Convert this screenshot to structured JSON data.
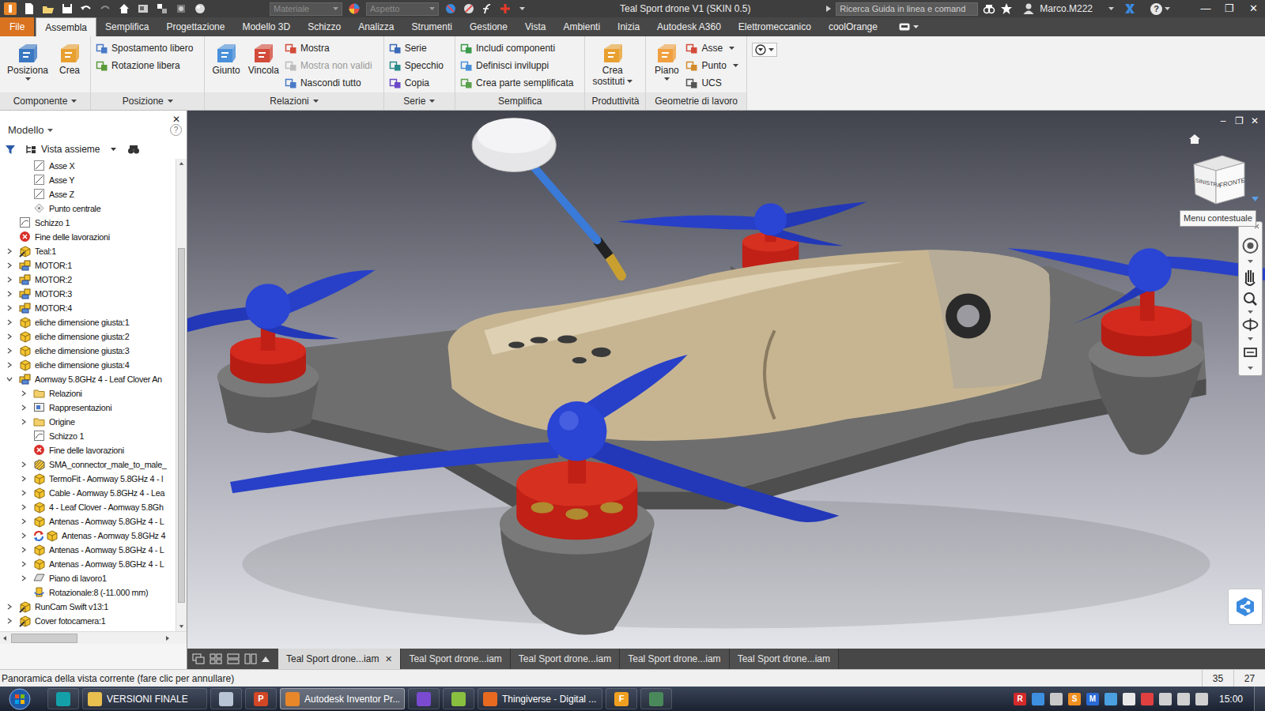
{
  "window": {
    "title": "Teal Sport drone V1 (SKIN 0.5)",
    "controls": [
      "—",
      "❐",
      "✕"
    ]
  },
  "title_bar": {
    "material": "Materiale",
    "appearance": "Aspetto",
    "search": {
      "placeholder": "Ricerca Guida in linea e comand"
    },
    "user": "Marco.M222",
    "help": "?"
  },
  "ribbon_tabs": [
    {
      "label": "File",
      "selected": false,
      "kind": "application"
    },
    {
      "label": "Assembla",
      "selected": true,
      "kind": "tab"
    },
    {
      "label": "Semplifica",
      "selected": false,
      "kind": "tab"
    },
    {
      "label": "Progettazione",
      "selected": false,
      "kind": "tab"
    },
    {
      "label": "Modello 3D",
      "selected": false,
      "kind": "tab"
    },
    {
      "label": "Schizzo",
      "selected": false,
      "kind": "tab"
    },
    {
      "label": "Analizza",
      "selected": false,
      "kind": "tab"
    },
    {
      "label": "Strumenti",
      "selected": false,
      "kind": "tab"
    },
    {
      "label": "Gestione",
      "selected": false,
      "kind": "tab"
    },
    {
      "label": "Vista",
      "selected": false,
      "kind": "tab"
    },
    {
      "label": "Ambienti",
      "selected": false,
      "kind": "tab"
    },
    {
      "label": "Inizia",
      "selected": false,
      "kind": "tab"
    },
    {
      "label": "Autodesk A360",
      "selected": false,
      "kind": "tab"
    },
    {
      "label": "Elettromeccanico",
      "selected": false,
      "kind": "tab"
    },
    {
      "label": "coolOrange",
      "selected": false,
      "kind": "tab"
    }
  ],
  "ribbon_panels": [
    {
      "label": "Componente",
      "menu": true,
      "buttons": [
        {
          "kind": "large",
          "lines": [
            "Posiziona"
          ],
          "dropdown": true,
          "disabled": false
        },
        {
          "kind": "large",
          "lines": [
            "Crea"
          ],
          "dropdown": false,
          "disabled": false
        }
      ]
    },
    {
      "label": "Posizione",
      "menu": true,
      "buttons": [
        {
          "kind": "small",
          "label": "Spostamento libero",
          "dropdown": false,
          "disabled": false
        },
        {
          "kind": "small",
          "label": "Rotazione libera",
          "dropdown": false,
          "disabled": false
        }
      ]
    },
    {
      "label": "Relazioni",
      "menu": true,
      "buttons": [
        {
          "kind": "large",
          "lines": [
            "Giunto"
          ],
          "dropdown": false,
          "disabled": false
        },
        {
          "kind": "large",
          "lines": [
            "Vincola"
          ],
          "dropdown": false,
          "disabled": false
        },
        {
          "kind": "small",
          "label": "Mostra",
          "dropdown": false,
          "disabled": false
        },
        {
          "kind": "small",
          "label": "Mostra non validi",
          "dropdown": false,
          "disabled": true
        },
        {
          "kind": "small",
          "label": "Nascondi tutto",
          "dropdown": false,
          "disabled": false
        }
      ]
    },
    {
      "label": "Serie",
      "menu": true,
      "buttons": [
        {
          "kind": "small",
          "label": "Serie",
          "dropdown": false,
          "disabled": false
        },
        {
          "kind": "small",
          "label": "Specchio",
          "dropdown": false,
          "disabled": false
        },
        {
          "kind": "small",
          "label": "Copia",
          "dropdown": false,
          "disabled": false
        }
      ]
    },
    {
      "label": "Semplifica",
      "menu": false,
      "buttons": [
        {
          "kind": "small",
          "label": "Includi componenti",
          "dropdown": false,
          "disabled": false
        },
        {
          "kind": "small",
          "label": "Definisci inviluppi",
          "dropdown": false,
          "disabled": false
        },
        {
          "kind": "small",
          "label": "Crea parte semplificata",
          "dropdown": false,
          "disabled": false
        }
      ]
    },
    {
      "label": "Produttività",
      "menu": false,
      "buttons": [
        {
          "kind": "large",
          "lines": [
            "Crea",
            "sostituti"
          ],
          "dropdown": true,
          "disabled": false
        }
      ]
    },
    {
      "label": "Geometrie di lavoro",
      "menu": false,
      "buttons": [
        {
          "kind": "large",
          "lines": [
            "Piano"
          ],
          "dropdown": true,
          "disabled": false
        },
        {
          "kind": "small",
          "label": "Asse",
          "dropdown": true,
          "disabled": false
        },
        {
          "kind": "small",
          "label": "Punto",
          "dropdown": true,
          "disabled": false
        },
        {
          "kind": "small",
          "label": "UCS",
          "dropdown": false,
          "disabled": false
        }
      ]
    }
  ],
  "browser": {
    "title": "Modello",
    "help": "?",
    "close": "✕",
    "view": "Vista assieme",
    "items": [
      {
        "label": "Asse X",
        "depth": 2,
        "kind": "axis",
        "has_children": false,
        "expanded": false
      },
      {
        "label": "Asse Y",
        "depth": 2,
        "kind": "axis",
        "has_children": false,
        "expanded": false
      },
      {
        "label": "Asse Z",
        "depth": 2,
        "kind": "axis",
        "has_children": false,
        "expanded": false
      },
      {
        "label": "Punto centrale",
        "depth": 2,
        "kind": "point",
        "has_children": false,
        "expanded": false
      },
      {
        "label": "Schizzo 1",
        "depth": 1,
        "kind": "sketch",
        "has_children": false,
        "expanded": false
      },
      {
        "label": "Fine delle lavorazioni",
        "depth": 1,
        "kind": "error",
        "has_children": false,
        "expanded": false
      },
      {
        "label": "Teal:1",
        "depth": 1,
        "kind": "part-edit",
        "has_children": true,
        "expanded": false
      },
      {
        "label": "MOTOR:1",
        "depth": 1,
        "kind": "assembly",
        "has_children": true,
        "expanded": false
      },
      {
        "label": "MOTOR:2",
        "depth": 1,
        "kind": "assembly",
        "has_children": true,
        "expanded": false
      },
      {
        "label": "MOTOR:3",
        "depth": 1,
        "kind": "assembly",
        "has_children": true,
        "expanded": false
      },
      {
        "label": "MOTOR:4",
        "depth": 1,
        "kind": "assembly",
        "has_children": true,
        "expanded": false
      },
      {
        "label": "eliche dimensione giusta:1",
        "depth": 1,
        "kind": "part",
        "has_children": true,
        "expanded": false
      },
      {
        "label": "eliche dimensione giusta:2",
        "depth": 1,
        "kind": "part",
        "has_children": true,
        "expanded": false
      },
      {
        "label": "eliche dimensione giusta:3",
        "depth": 1,
        "kind": "part",
        "has_children": true,
        "expanded": false
      },
      {
        "label": "eliche dimensione giusta:4",
        "depth": 1,
        "kind": "part",
        "has_children": true,
        "expanded": false
      },
      {
        "label": "Aomway 5.8GHz 4 - Leaf Clover An",
        "depth": 1,
        "kind": "assembly",
        "has_children": true,
        "expanded": true
      },
      {
        "label": "Relazioni",
        "depth": 2,
        "kind": "folder",
        "has_children": true,
        "expanded": false
      },
      {
        "label": "Rappresentazioni",
        "depth": 2,
        "kind": "views",
        "has_children": true,
        "expanded": false
      },
      {
        "label": "Origine",
        "depth": 2,
        "kind": "folder",
        "has_children": true,
        "expanded": false
      },
      {
        "label": "Schizzo 1",
        "depth": 2,
        "kind": "sketch",
        "has_children": false,
        "expanded": false
      },
      {
        "label": "Fine delle lavorazioni",
        "depth": 2,
        "kind": "error",
        "has_children": false,
        "expanded": false
      },
      {
        "label": "SMA_connector_male_to_male_",
        "depth": 2,
        "kind": "part-hatched",
        "has_children": true,
        "expanded": false
      },
      {
        "label": "TermoFit - Aomway 5.8GHz 4 - l",
        "depth": 2,
        "kind": "part",
        "has_children": true,
        "expanded": false
      },
      {
        "label": "Cable - Aomway 5.8GHz 4 - Lea",
        "depth": 2,
        "kind": "part",
        "has_children": true,
        "expanded": false
      },
      {
        "label": "4 - Leaf Clover - Aomway 5.8Gh",
        "depth": 2,
        "kind": "part",
        "has_children": true,
        "expanded": false
      },
      {
        "label": "Antenas - Aomway 5.8GHz 4 - L",
        "depth": 2,
        "kind": "part",
        "has_children": true,
        "expanded": false
      },
      {
        "label": "Antenas - Aomway 5.8GHz 4",
        "depth": 2,
        "kind": "adaptive",
        "has_children": true,
        "expanded": false
      },
      {
        "label": "Antenas - Aomway 5.8GHz 4 - L",
        "depth": 2,
        "kind": "part",
        "has_children": true,
        "expanded": false
      },
      {
        "label": "Antenas - Aomway 5.8GHz 4 - L",
        "depth": 2,
        "kind": "part",
        "has_children": true,
        "expanded": false
      },
      {
        "label": "Piano di lavoro1",
        "depth": 2,
        "kind": "plane",
        "has_children": true,
        "expanded": false
      },
      {
        "label": "Rotazionale:8 (-11.000 mm)",
        "depth": 2,
        "kind": "feature",
        "has_children": false,
        "expanded": false
      },
      {
        "label": "RunCam Swift v13:1",
        "depth": 1,
        "kind": "part-edit",
        "has_children": true,
        "expanded": false
      },
      {
        "label": "Cover fotocamera:1",
        "depth": 1,
        "kind": "part-edit",
        "has_children": true,
        "expanded": false
      }
    ]
  },
  "viewport": {
    "controls": [
      "–",
      "❐",
      "✕"
    ],
    "view_cube": {
      "left": "SINISTRA",
      "front": "FRONTE"
    },
    "tooltip": "Menu contestuale"
  },
  "document_tabs": {
    "close": "✕",
    "items": [
      {
        "label": "Teal Sport drone...iam",
        "selected": true
      },
      {
        "label": "Teal Sport drone...iam",
        "selected": false
      },
      {
        "label": "Teal Sport drone...iam",
        "selected": false
      },
      {
        "label": "Teal Sport drone...iam",
        "selected": false
      },
      {
        "label": "Teal Sport drone...iam",
        "selected": false
      }
    ]
  },
  "status_bar": {
    "message": "Panoramica della vista corrente (fare clic per annullare)",
    "values": [
      "35",
      "27"
    ]
  },
  "taskbar": {
    "items": [
      {
        "kind": "icon",
        "label": "",
        "glyph": "",
        "active": false,
        "color": "#14a0a8"
      },
      {
        "kind": "button",
        "label": "VERSIONI FINALE",
        "glyph": "",
        "active": false,
        "color": "#e8c050"
      },
      {
        "kind": "icon",
        "label": "",
        "glyph": "",
        "active": false,
        "color": "#b8c4d4"
      },
      {
        "kind": "icon",
        "label": "",
        "glyph": "P",
        "active": false,
        "color": "#d24726"
      },
      {
        "kind": "button",
        "label": "Autodesk Inventor Pr...",
        "glyph": "",
        "active": true,
        "color": "#e8862a"
      },
      {
        "kind": "icon",
        "label": "",
        "glyph": "",
        "active": false,
        "color": "#7a4ad0"
      },
      {
        "kind": "icon",
        "label": "",
        "glyph": "",
        "active": false,
        "color": "#8ac040"
      },
      {
        "kind": "button",
        "label": "Thingiverse - Digital ...",
        "glyph": "",
        "active": false,
        "color": "#e86a20"
      },
      {
        "kind": "icon",
        "label": "",
        "glyph": "F",
        "active": false,
        "color": "#f0a020"
      },
      {
        "kind": "icon",
        "label": "",
        "glyph": "",
        "active": false,
        "color": "#4a8a5a"
      }
    ],
    "tray": [
      {
        "glyph": "R",
        "color": "#d42a2a"
      },
      {
        "glyph": "",
        "color": "#3d8fe0"
      },
      {
        "glyph": "",
        "color": "#c8c8c8"
      },
      {
        "glyph": "S",
        "color": "#f09020"
      },
      {
        "glyph": "M",
        "color": "#2a6ad4"
      },
      {
        "glyph": "",
        "color": "#4aa0e0"
      },
      {
        "glyph": "",
        "color": "#e8e8e8"
      },
      {
        "glyph": "",
        "color": "#e04040"
      },
      {
        "glyph": "",
        "color": "#d0d0d0"
      },
      {
        "glyph": "",
        "color": "#d0d0d0"
      },
      {
        "glyph": "",
        "color": "#d0d0d0"
      }
    ],
    "time": "15:00"
  }
}
